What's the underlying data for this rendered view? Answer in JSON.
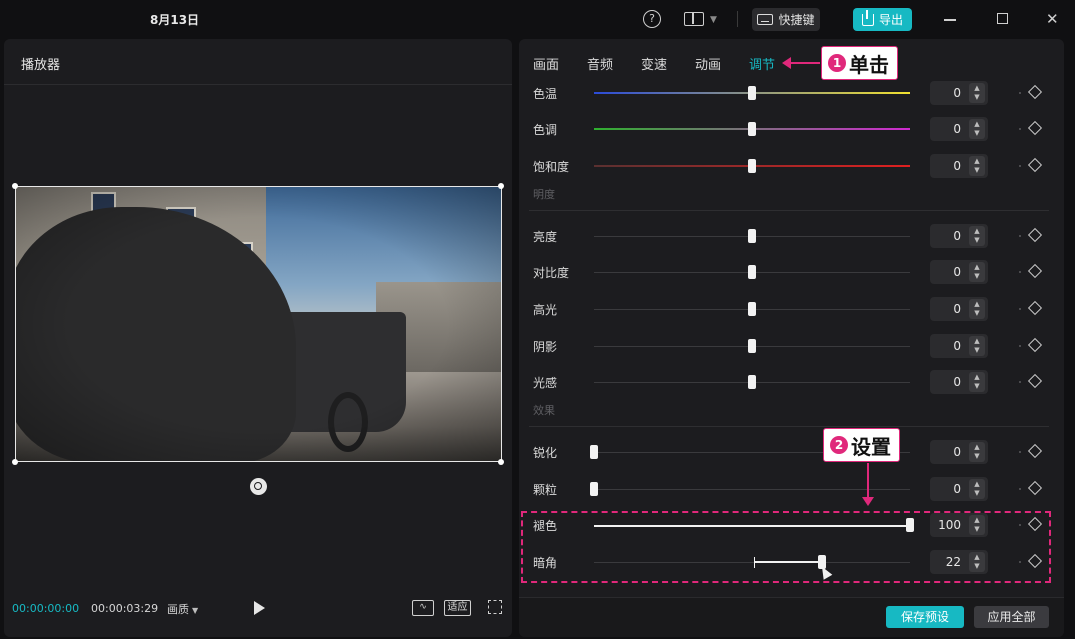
{
  "topbar": {
    "date": "8月13日",
    "help_icon": "?",
    "shortcut_label": "快捷键",
    "export_label": "导出",
    "close_glyph": "✕"
  },
  "player": {
    "title": "播放器",
    "current_time": "00:00:00:00",
    "duration": "00:00:03:29",
    "quality_label": "画质",
    "wave_glyph": "∿",
    "fit_label": "适应"
  },
  "panel": {
    "tabs": [
      {
        "label": "画面"
      },
      {
        "label": "音频"
      },
      {
        "label": "变速"
      },
      {
        "label": "动画"
      },
      {
        "label": "调节",
        "active": true
      }
    ],
    "groups": {
      "brightness": "明度",
      "effects": "效果"
    },
    "rows": [
      {
        "label": "色温",
        "value": "0",
        "range": [
          -50,
          50
        ],
        "level": 0
      },
      {
        "label": "色调",
        "value": "0",
        "range": [
          -50,
          50
        ],
        "level": 0
      },
      {
        "label": "饱和度",
        "value": "0",
        "range": [
          -50,
          50
        ],
        "level": 0
      },
      {
        "label": "亮度",
        "value": "0",
        "range": [
          -50,
          50
        ],
        "level": 0
      },
      {
        "label": "对比度",
        "value": "0",
        "range": [
          -50,
          50
        ],
        "level": 0
      },
      {
        "label": "高光",
        "value": "0",
        "range": [
          -50,
          50
        ],
        "level": 0
      },
      {
        "label": "阴影",
        "value": "0",
        "range": [
          -50,
          50
        ],
        "level": 0
      },
      {
        "label": "光感",
        "value": "0",
        "range": [
          -50,
          50
        ],
        "level": 0
      },
      {
        "label": "锐化",
        "value": "0",
        "range": [
          0,
          100
        ],
        "level": 0
      },
      {
        "label": "颗粒",
        "value": "0",
        "range": [
          0,
          100
        ],
        "level": 0
      },
      {
        "label": "褪色",
        "value": "100",
        "range": [
          0,
          100
        ],
        "level": 100
      },
      {
        "label": "暗角",
        "value": "22",
        "range": [
          -50,
          50
        ],
        "level": 22
      }
    ],
    "save_preset_label": "保存预设",
    "apply_all_label": "应用全部"
  },
  "callouts": {
    "step1_num": "1",
    "step1_text": "单击",
    "step2_num": "2",
    "step2_text": "设置"
  },
  "colors": {
    "accent": "#17b9c3",
    "callout": "#e0287b",
    "panel_bg": "#1c1c1f"
  }
}
